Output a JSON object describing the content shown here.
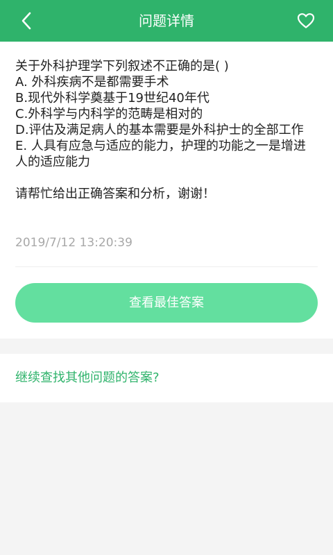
{
  "header": {
    "title": "问题详情",
    "back_icon": "chevron-left-icon",
    "favorite_icon": "heart-icon",
    "bg_color": "#2fb36b"
  },
  "question": {
    "lines": [
      "关于外科护理学下列叙述不正确的是( )",
      "A. 外科疾病不是都需要手术",
      "B.现代外科学奠基于19世纪40年代",
      "C.外科学与内科学的范畴是相对的",
      "D.评估及满足病人的基本需要是外科护士的全部工作",
      "E. 人具有应急与适应的能力，护理的功能之一是增进人的适应能力"
    ],
    "request": "请帮忙给出正确答案和分析，谢谢！",
    "timestamp": "2019/7/12 13:20:39"
  },
  "actions": {
    "view_answer_label": "查看最佳答案",
    "button_color": "#63df9f"
  },
  "more": {
    "link_label": "继续查找其他问题的答案?",
    "link_color": "#2fb36b"
  }
}
